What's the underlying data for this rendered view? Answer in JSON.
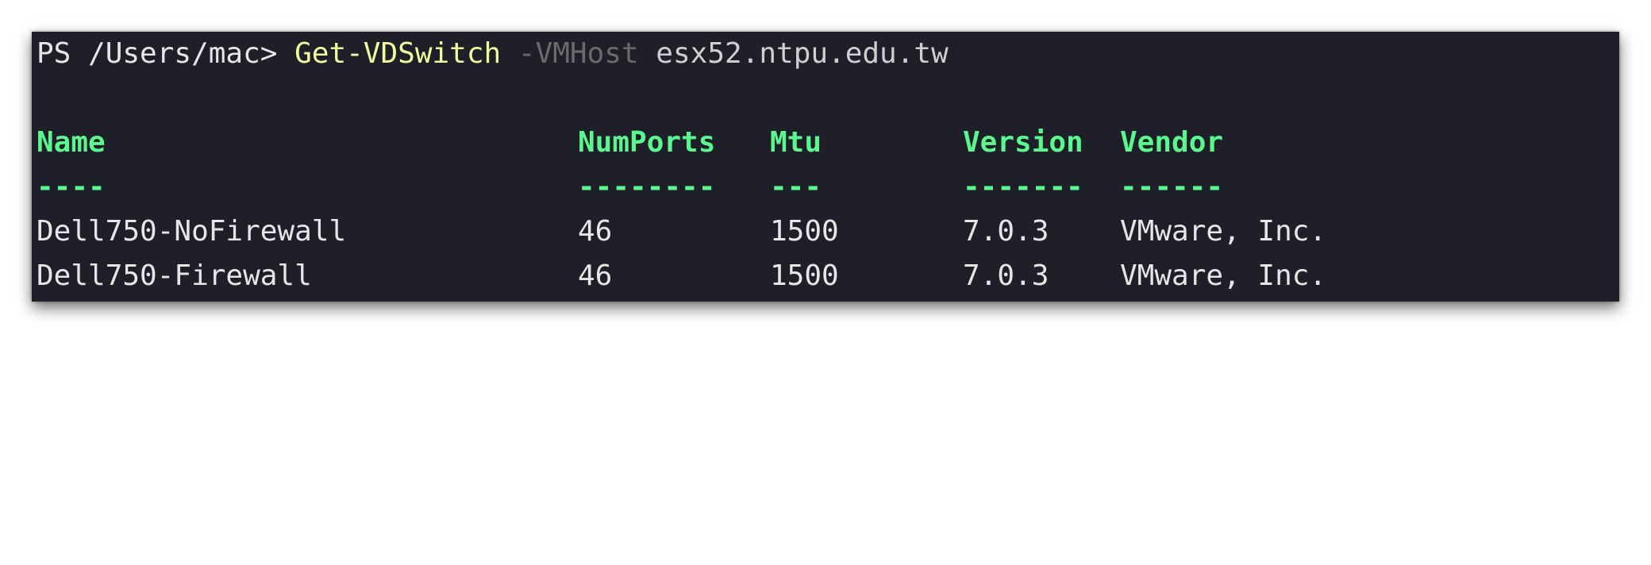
{
  "terminal": {
    "prompt": "PS /Users/mac> ",
    "command": {
      "cmdlet": "Get-VDSwitch",
      "parameter": "-VMHost",
      "argument": "esx52.ntpu.edu.tw"
    },
    "table": {
      "headers": [
        "Name",
        "NumPorts",
        "Mtu",
        "Version",
        "Vendor"
      ],
      "separators": [
        "----",
        "--------",
        "---",
        "-------",
        "------"
      ],
      "rows": [
        [
          "Dell750-NoFirewall",
          "46",
          "1500",
          "7.0.3",
          "VMware, Inc."
        ],
        [
          "Dell750-Firewall",
          "46",
          "1500",
          "7.0.3",
          "VMware, Inc."
        ]
      ]
    }
  },
  "colors": {
    "background": "#1f1f29",
    "text": "#e6e6e6",
    "cmdlet": "#f3f99d",
    "parameter": "#6a6a6a",
    "header": "#5af78e"
  }
}
